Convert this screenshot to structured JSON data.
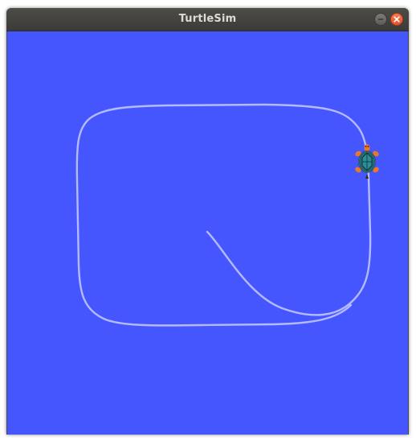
{
  "window": {
    "title": "TurtleSim",
    "buttons": {
      "minimize_icon": "minimize-icon",
      "close_icon": "close-icon"
    }
  },
  "canvas": {
    "background_color": "#4556ff",
    "trail_color": "#b4baff",
    "turtle_icon": "turtle-icon"
  }
}
